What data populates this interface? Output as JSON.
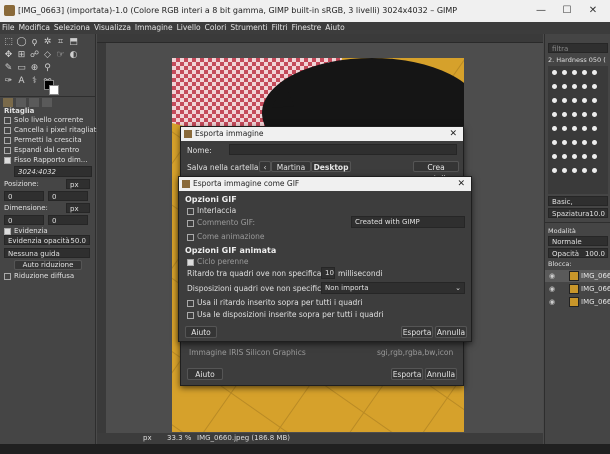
{
  "window": {
    "title": "[IMG_0663] (importata)-1.0 (Colore RGB interi a 8 bit gamma, GIMP built-in sRGB, 3 livelli) 3024x4032 – GIMP",
    "min": "—",
    "max": "☐",
    "close": "✕"
  },
  "menu": [
    "File",
    "Modifica",
    "Seleziona",
    "Visualizza",
    "Immagine",
    "Livello",
    "Colori",
    "Strumenti",
    "Filtri",
    "Finestre",
    "Aiuto"
  ],
  "tool_options": {
    "title": "Ritaglia",
    "only_current_layer": "Solo livello corrente",
    "delete_cropped": "Cancella i pixel ritagliati",
    "allow_grow": "Permetti la crescita",
    "expand_center": "Espandi dal centro",
    "fixed": "Fisso Rapporto dim...",
    "ratio": "3024:4032",
    "position_label": "Posizione:",
    "position_unit": "px",
    "pos_x": "0",
    "pos_y": "0",
    "size_label": "Dimensione:",
    "size_unit": "px",
    "size_w": "0",
    "size_h": "0",
    "highlight": "Evidenzia",
    "highlight_opacity_label": "Evidenzia opacità",
    "highlight_opacity": "50.0",
    "guides": "Nessuna guida",
    "auto_shrink": "Auto riduzione",
    "shrink_merged": "Riduzione diffusa"
  },
  "status": {
    "unit": "px",
    "zoom": "33.3 %",
    "file": "IMG_0660.jpeg (186.8 MB)"
  },
  "dock": {
    "filter_placeholder": "filtra",
    "brush_name": "2. Hardness 050 (",
    "preset": "Basic,",
    "spacing_label": "Spaziatura",
    "spacing_value": "10.0",
    "mode_label": "Modalità",
    "mode_value": "Normale",
    "opacity_label": "Opacità",
    "opacity_value": "100.0",
    "lock_label": "Blocca:",
    "layers": [
      "IMG_066",
      "IMG_066",
      "IMG_066"
    ]
  },
  "export_dialog": {
    "title": "Esporta immagine",
    "name_label": "Nome:",
    "save_in_label": "Salva nella cartella:",
    "path": [
      "Martina",
      "Desktop"
    ],
    "create_folder": "Crea cartella",
    "filetype_row_name": "Immagine IRIS Silicon Graphics",
    "filetype_row_ext": "sgi,rgb,rgba,bw,icon",
    "help": "Aiuto",
    "export": "Esporta",
    "cancel": "Annulla"
  },
  "gif_dialog": {
    "title": "Esporta immagine come GIF",
    "gif_options": "Opzioni GIF",
    "interlace": "Interlaccia",
    "gif_comment_label": "Commento GIF:",
    "gif_comment_value": "Created with GIMP",
    "as_animation": "Come animazione",
    "anim_options": "Opzioni GIF animata",
    "loop_forever": "Ciclo perenne",
    "delay_label": "Ritardo tra quadri ove non specificato:",
    "delay_value": "10",
    "delay_unit": "millisecondi",
    "disposal_label": "Disposizioni quadri ove non specificato:",
    "disposal_value": "Non importa",
    "use_delay": "Usa il ritardo inserito sopra per tutti i quadri",
    "use_disposal": "Usa le disposizioni inserite sopra per tutti i quadri",
    "help": "Aiuto",
    "export": "Esporta",
    "cancel": "Annulla"
  }
}
